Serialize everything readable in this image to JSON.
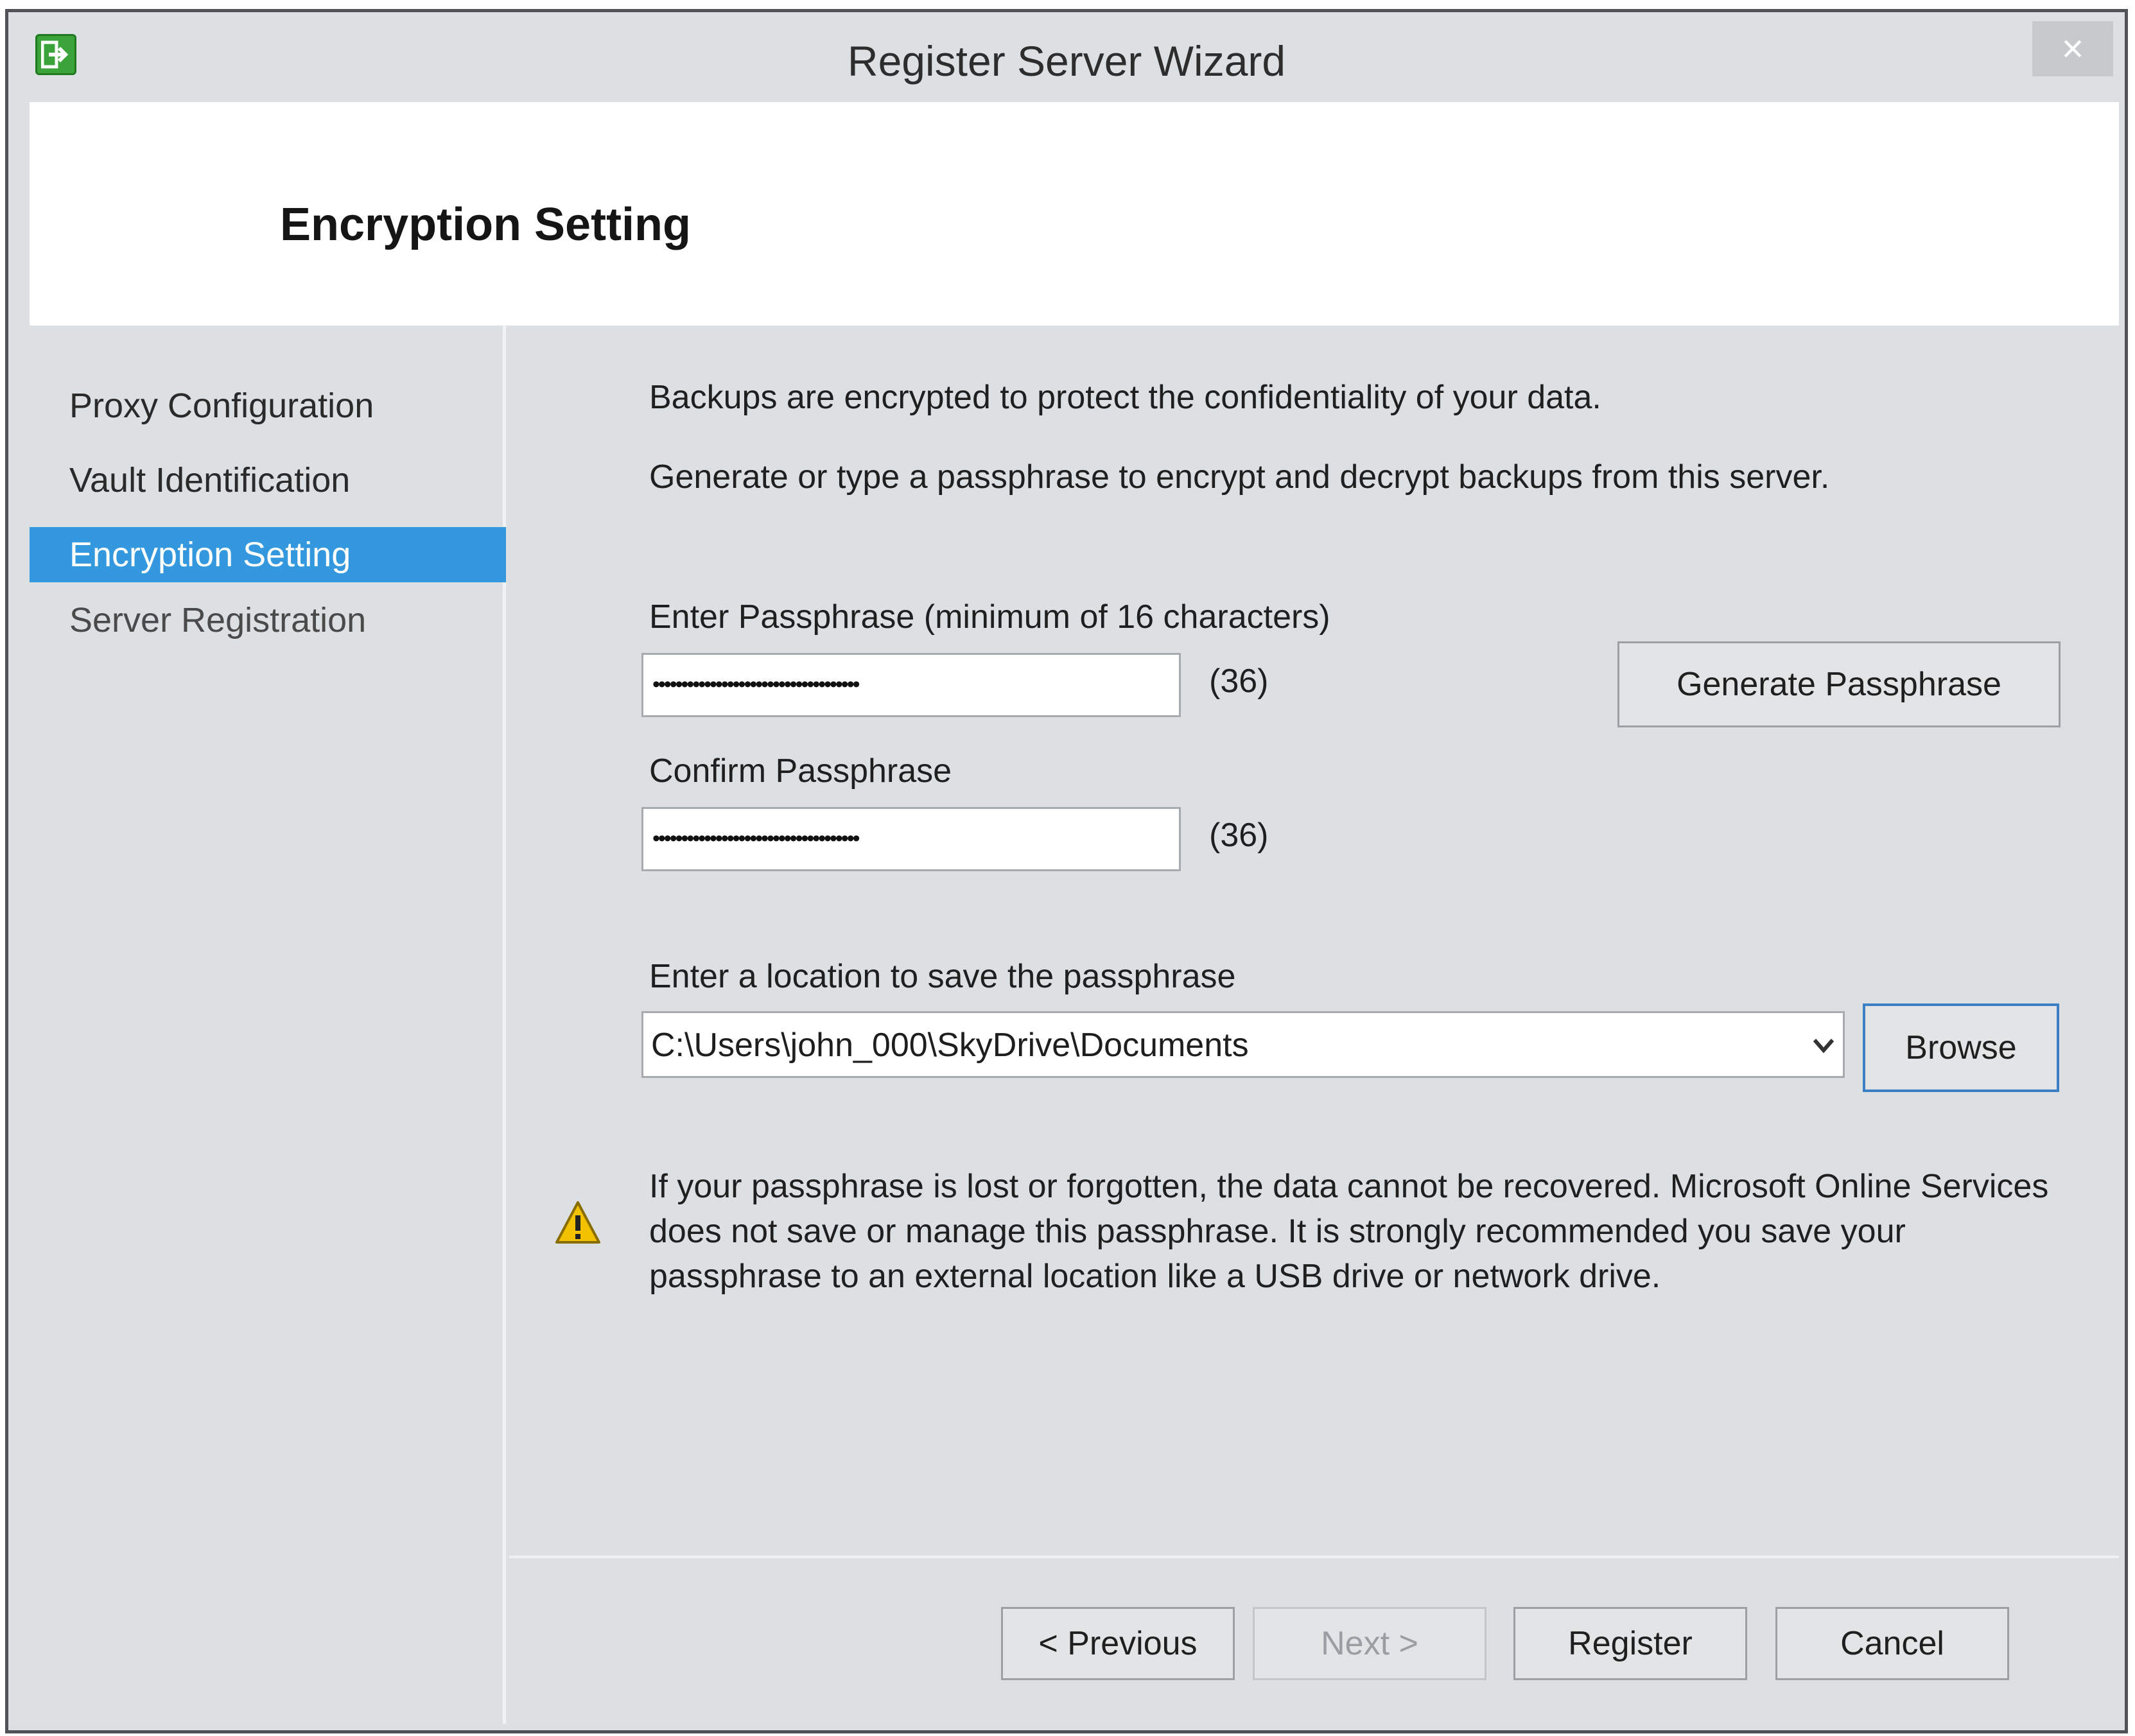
{
  "window": {
    "title": "Register Server Wizard",
    "close_symbol": "×",
    "app_icon": "arrow-into-box-icon"
  },
  "header": {
    "title": "Encryption Setting"
  },
  "nav": {
    "items": [
      {
        "label": "Proxy Configuration",
        "state": "done"
      },
      {
        "label": "Vault Identification",
        "state": "done"
      },
      {
        "label": "Encryption Setting",
        "state": "current"
      },
      {
        "label": "Server Registration",
        "state": "pending"
      }
    ]
  },
  "content": {
    "intro_line1": "Backups are encrypted to protect the confidentiality of your data.",
    "intro_line2": "Generate or type a passphrase to encrypt and decrypt backups from this server.",
    "passphrase_label": "Enter Passphrase (minimum of 16 characters)",
    "passphrase_masked": "••••••••••••••••••••••••••••••••••••",
    "passphrase_count": "(36)",
    "confirm_label": "Confirm Passphrase",
    "confirm_masked": "••••••••••••••••••••••••••••••••••••",
    "confirm_count": "(36)",
    "generate_button": "Generate Passphrase",
    "location_label": "Enter a location to save the passphrase",
    "location_value": "C:\\Users\\john_000\\SkyDrive\\Documents",
    "browse_button": "Browse",
    "warning_icon": "warning-triangle-icon",
    "warning_text": "If your passphrase is lost or forgotten, the data cannot be recovered. Microsoft Online Services does not save or manage this passphrase. It is strongly recommended you save your passphrase to an external location like a USB drive or network drive."
  },
  "footer": {
    "previous": "< Previous",
    "next": "Next >",
    "register": "Register",
    "cancel": "Cancel"
  },
  "colors": {
    "selection": "#3398de",
    "dialog_bg": "#dde0e3",
    "warning": "#f2c200"
  }
}
